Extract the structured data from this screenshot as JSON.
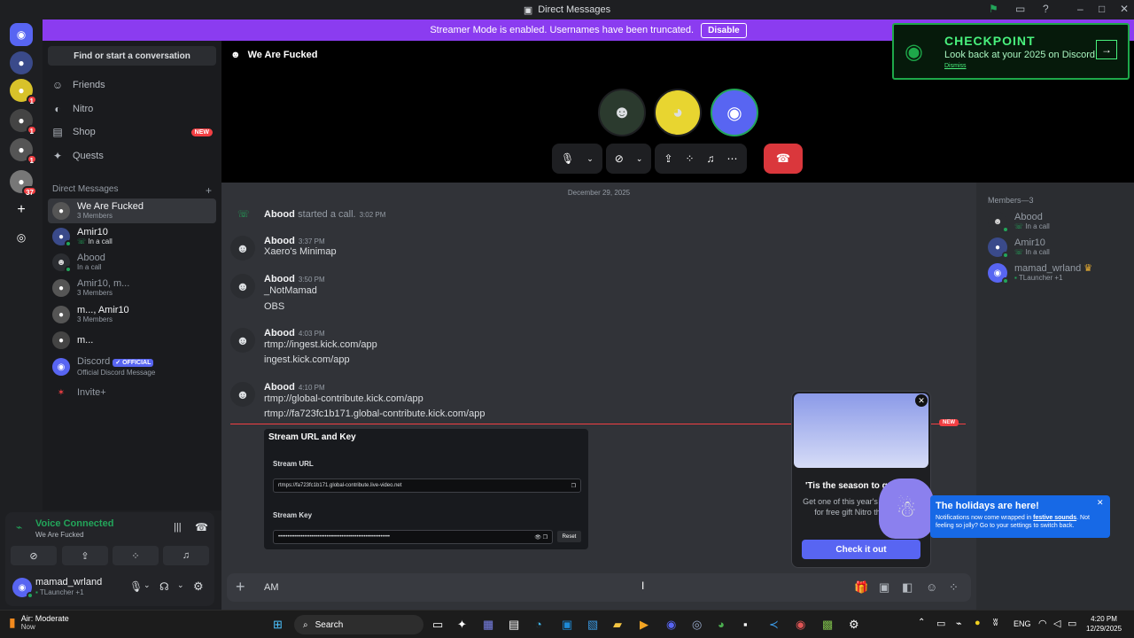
{
  "window": {
    "title": "Direct Messages"
  },
  "banner": {
    "text": "Streamer Mode is enabled. Usernames have been truncated.",
    "button": "Disable"
  },
  "servers": [
    {
      "name": "Home",
      "icon": "discord-icon",
      "badge": ""
    },
    {
      "name": "Server 1",
      "icon": "avatar",
      "badge": ""
    },
    {
      "name": "Server 2",
      "icon": "avatar",
      "badge": "1"
    },
    {
      "name": "Server 3",
      "icon": "avatar",
      "badge": "1"
    },
    {
      "name": "Server 4",
      "icon": "avatar",
      "badge": "1"
    },
    {
      "name": "Server 5",
      "icon": "avatar",
      "badge": "37"
    }
  ],
  "sidebar": {
    "find_placeholder": "Find or start a conversation",
    "nav": [
      {
        "label": "Friends",
        "icon": "friends-icon"
      },
      {
        "label": "Nitro",
        "icon": "nitro-icon"
      },
      {
        "label": "Shop",
        "icon": "shop-icon",
        "badge": "NEW"
      },
      {
        "label": "Quests",
        "icon": "quests-icon"
      }
    ],
    "dm_header": "Direct Messages",
    "dm_add": "+",
    "dms": [
      {
        "name": "We Are Fucked",
        "sub": "3 Members",
        "active": true
      },
      {
        "name": "Amir10",
        "sub": "In a call",
        "active": false
      },
      {
        "name": "Abood",
        "sub": "In a call",
        "active": false
      },
      {
        "name": "Amir10, m...",
        "sub": "3 Members",
        "active": false
      },
      {
        "name": "m..., Amir10",
        "sub": "3 Members",
        "active": false
      },
      {
        "name": "m...",
        "sub": "",
        "active": false
      },
      {
        "name": "Discord",
        "sub": "Official Discord Message",
        "badge": "OFFICIAL",
        "active": false
      },
      {
        "name": "Invite+",
        "sub": "",
        "active": false
      }
    ]
  },
  "voice": {
    "status": "Voice Connected",
    "channel": "We Are Fucked"
  },
  "user": {
    "name": "mamad_wrland",
    "activity": "TLauncher +1"
  },
  "call": {
    "title": "We Are Fucked"
  },
  "chat": {
    "date": "December 29, 2025",
    "system": {
      "user": "Abood",
      "text": "started a call.",
      "time": "3:02 PM"
    },
    "messages": [
      {
        "user": "Abood",
        "time": "3:37 PM",
        "lines": [
          "Xaero's Minimap"
        ]
      },
      {
        "user": "Abood",
        "time": "3:50 PM",
        "lines": [
          "_NotMamad",
          "OBS"
        ]
      },
      {
        "user": "Abood",
        "time": "4:03 PM",
        "lines": [
          "rtmp://ingest.kick.com/app",
          "ingest.kick.com/app"
        ]
      },
      {
        "user": "Abood",
        "time": "4:10 PM",
        "lines": [
          "rtmp://global-contribute.kick.com/app",
          "rtmp://fa723fc1b171.global-contribute.kick.com/app"
        ]
      }
    ],
    "new_label": "NEW",
    "embed": {
      "title": "Stream URL and Key",
      "url_label": "Stream URL",
      "url_value": "rtmps://fa723fc1b171.global-contribute.live-video.net",
      "key_label": "Stream Key",
      "key_value": "••••••••••••••••••••••••••••••••••••••••••••••••••••••••••••",
      "reset": "Reset"
    }
  },
  "composer": {
    "value": "AM"
  },
  "members": {
    "header": "Members—3",
    "list": [
      {
        "name": "Abood",
        "sub": "In a call"
      },
      {
        "name": "Amir10",
        "sub": "In a call"
      },
      {
        "name": "mamad_wrland",
        "sub": "TLauncher +1"
      }
    ]
  },
  "checkpoint": {
    "title": "CHECKPOINT",
    "subtitle": "Look back at your 2025 on Discord",
    "dismiss": "Dismiss"
  },
  "promo": {
    "title": "'Tis the season to g",
    "body": "Get one of this year's decorations for free gift Nitro this holida",
    "cta": "Check it out"
  },
  "holiday": {
    "title": "The holidays are here!",
    "body_pre": "Notifications now come wrapped in",
    "body_link": "festive sounds",
    "body_post": ". Not feeling so jolly? Go to your settings to switch back."
  },
  "taskbar": {
    "weather": "Air: Moderate",
    "weather_sub": "Now",
    "search": "Search",
    "lang": "ENG",
    "time": "4:20 PM",
    "date": "12/29/2025"
  },
  "colors": {
    "blurple": "#5865f2",
    "green": "#23a55a",
    "red": "#da373c",
    "banner": "#8b3cf0"
  }
}
